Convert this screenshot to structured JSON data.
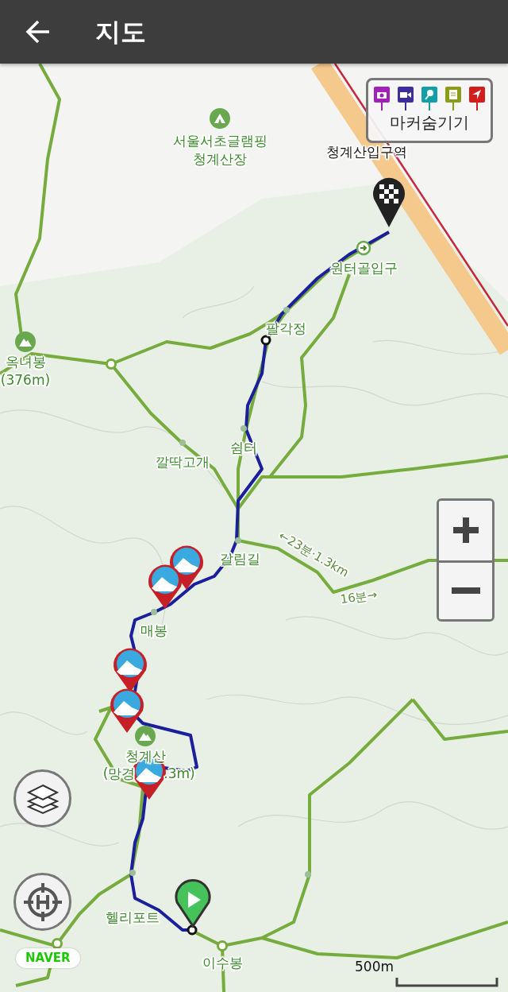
{
  "header": {
    "title": "지도"
  },
  "marker_legend": {
    "label": "마커숨기기",
    "markers": [
      {
        "kind": "camera",
        "color": "#a020b8"
      },
      {
        "kind": "video",
        "color": "#3a2f9c"
      },
      {
        "kind": "pin",
        "color": "#12a0a6"
      },
      {
        "kind": "note",
        "color": "#8a9c18"
      },
      {
        "kind": "flag",
        "color": "#d41c1c"
      }
    ]
  },
  "map": {
    "labels": [
      {
        "text": "서울서초글램핑\n청계산장",
        "kind": "camp"
      },
      {
        "text": "청계산입구역",
        "kind": "station"
      },
      {
        "text": "원터골입구",
        "kind": "entrance"
      },
      {
        "text": "팔각정",
        "kind": "junction"
      },
      {
        "text": "옥녀봉\n(376m)",
        "kind": "peak"
      },
      {
        "text": "깔딱고개",
        "kind": "junction"
      },
      {
        "text": "쉼터",
        "kind": "junction"
      },
      {
        "text": "갈림길",
        "kind": "junction"
      },
      {
        "text": "←23분·1.3km",
        "kind": "trail-time"
      },
      {
        "text": "16분→",
        "kind": "trail-time"
      },
      {
        "text": "매봉",
        "kind": "junction"
      },
      {
        "text": "청계산",
        "kind": "peak"
      },
      {
        "text": "(망경",
        "kind": "junction"
      },
      {
        "text": ".3m)",
        "kind": "junction"
      },
      {
        "text": "헬리포트",
        "kind": "junction"
      },
      {
        "text": "이수봉",
        "kind": "junction"
      }
    ]
  },
  "attribution": "NAVER",
  "scale": "500m"
}
